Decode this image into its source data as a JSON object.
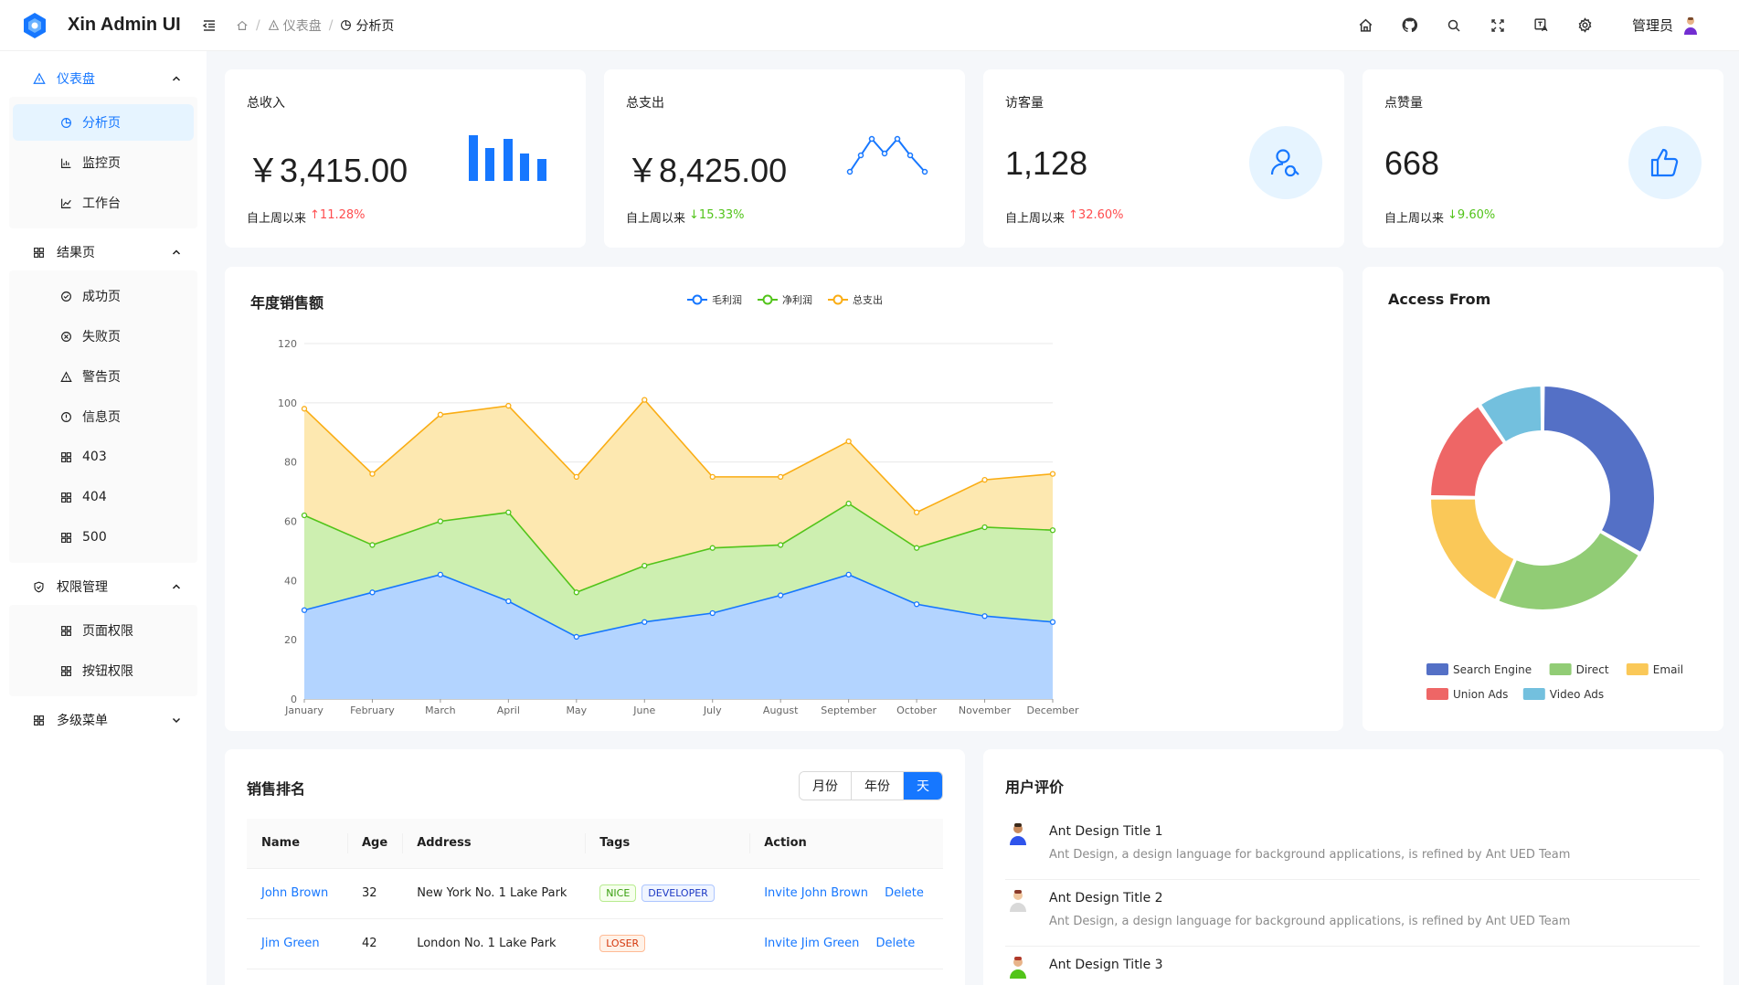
{
  "header": {
    "app_title": "Xin Admin UI",
    "breadcrumb": [
      {
        "label": ""
      },
      {
        "label": "仪表盘"
      },
      {
        "label": "分析页"
      }
    ],
    "user_name": "管理员",
    "icons": [
      "home-icon",
      "github-icon",
      "search-icon",
      "fullscreen-icon",
      "translate-icon",
      "gear-icon"
    ]
  },
  "sidebar": {
    "groups": [
      {
        "label": "仪表盘",
        "items": [
          "分析页",
          "监控页",
          "工作台"
        ]
      },
      {
        "label": "结果页",
        "items": [
          "成功页",
          "失败页",
          "警告页",
          "信息页",
          "403",
          "404",
          "500"
        ]
      },
      {
        "label": "权限管理",
        "items": [
          "页面权限",
          "按钮权限"
        ]
      },
      {
        "label": "多级菜单",
        "items": []
      }
    ]
  },
  "stats": [
    {
      "label": "总收入",
      "value": "￥3,415.00",
      "foot_label": "自上周以来",
      "change": "11.28%",
      "direction": "up"
    },
    {
      "label": "总支出",
      "value": "￥8,425.00",
      "foot_label": "自上周以来",
      "change": "15.33%",
      "direction": "down"
    },
    {
      "label": "访客量",
      "value": "1,128",
      "foot_label": "自上周以来",
      "change": "32.60%",
      "direction": "up"
    },
    {
      "label": "点赞量",
      "value": "668",
      "foot_label": "自上周以来",
      "change": "9.60%",
      "direction": "down"
    }
  ],
  "colors": {
    "accent": "#1677ff",
    "up": "#ff4d4f",
    "down": "#52c41a"
  },
  "chart_data": [
    {
      "type": "area",
      "title": "年度销售额",
      "categories": [
        "January",
        "February",
        "March",
        "April",
        "May",
        "June",
        "July",
        "August",
        "September",
        "October",
        "November",
        "December"
      ],
      "ylim": [
        0,
        120
      ],
      "yticks": [
        0,
        20,
        40,
        60,
        80,
        100,
        120
      ],
      "grid": true,
      "legend": "top-center",
      "series": [
        {
          "name": "毛利润",
          "color": "#1677ff",
          "values": [
            30,
            36,
            42,
            33,
            21,
            26,
            29,
            35,
            42,
            32,
            28,
            26
          ]
        },
        {
          "name": "净利润",
          "color": "#52c41a",
          "values": [
            62,
            52,
            60,
            63,
            36,
            45,
            51,
            52,
            66,
            51,
            58,
            57
          ]
        },
        {
          "name": "总支出",
          "color": "#faad14",
          "values": [
            98,
            76,
            96,
            99,
            75,
            101,
            75,
            75,
            87,
            63,
            74,
            76
          ]
        }
      ]
    },
    {
      "type": "pie",
      "title": "Access From",
      "legend": "bottom",
      "series": [
        {
          "name": "Search Engine",
          "color": "#5470c6",
          "value": 1048
        },
        {
          "name": "Direct",
          "color": "#91cc75",
          "value": 735
        },
        {
          "name": "Email",
          "color": "#fac858",
          "value": 580
        },
        {
          "name": "Union Ads",
          "color": "#ee6666",
          "value": 484
        },
        {
          "name": "Video Ads",
          "color": "#73c0de",
          "value": 300
        }
      ]
    }
  ],
  "ranking": {
    "title": "销售排名",
    "segments": [
      "月份",
      "年份",
      "天"
    ],
    "active_segment": 2,
    "columns": [
      "Name",
      "Age",
      "Address",
      "Tags",
      "Action"
    ],
    "rows": [
      {
        "name": "John Brown",
        "age": "32",
        "address": "New York No. 1 Lake Park",
        "tags": [
          {
            "text": "NICE",
            "color": "green"
          },
          {
            "text": "DEVELOPER",
            "color": "geek"
          }
        ],
        "invite": "Invite John Brown",
        "delete": "Delete"
      },
      {
        "name": "Jim Green",
        "age": "42",
        "address": "London No. 1 Lake Park",
        "tags": [
          {
            "text": "LOSER",
            "color": "volcano"
          }
        ],
        "invite": "Invite Jim Green",
        "delete": "Delete"
      }
    ]
  },
  "reviews": {
    "title": "用户评价",
    "items": [
      {
        "title": "Ant Design Title 1",
        "desc": "Ant Design, a design language for background applications, is refined by Ant UED Team"
      },
      {
        "title": "Ant Design Title 2",
        "desc": "Ant Design, a design language for background applications, is refined by Ant UED Team"
      },
      {
        "title": "Ant Design Title 3",
        "desc": ""
      }
    ]
  }
}
